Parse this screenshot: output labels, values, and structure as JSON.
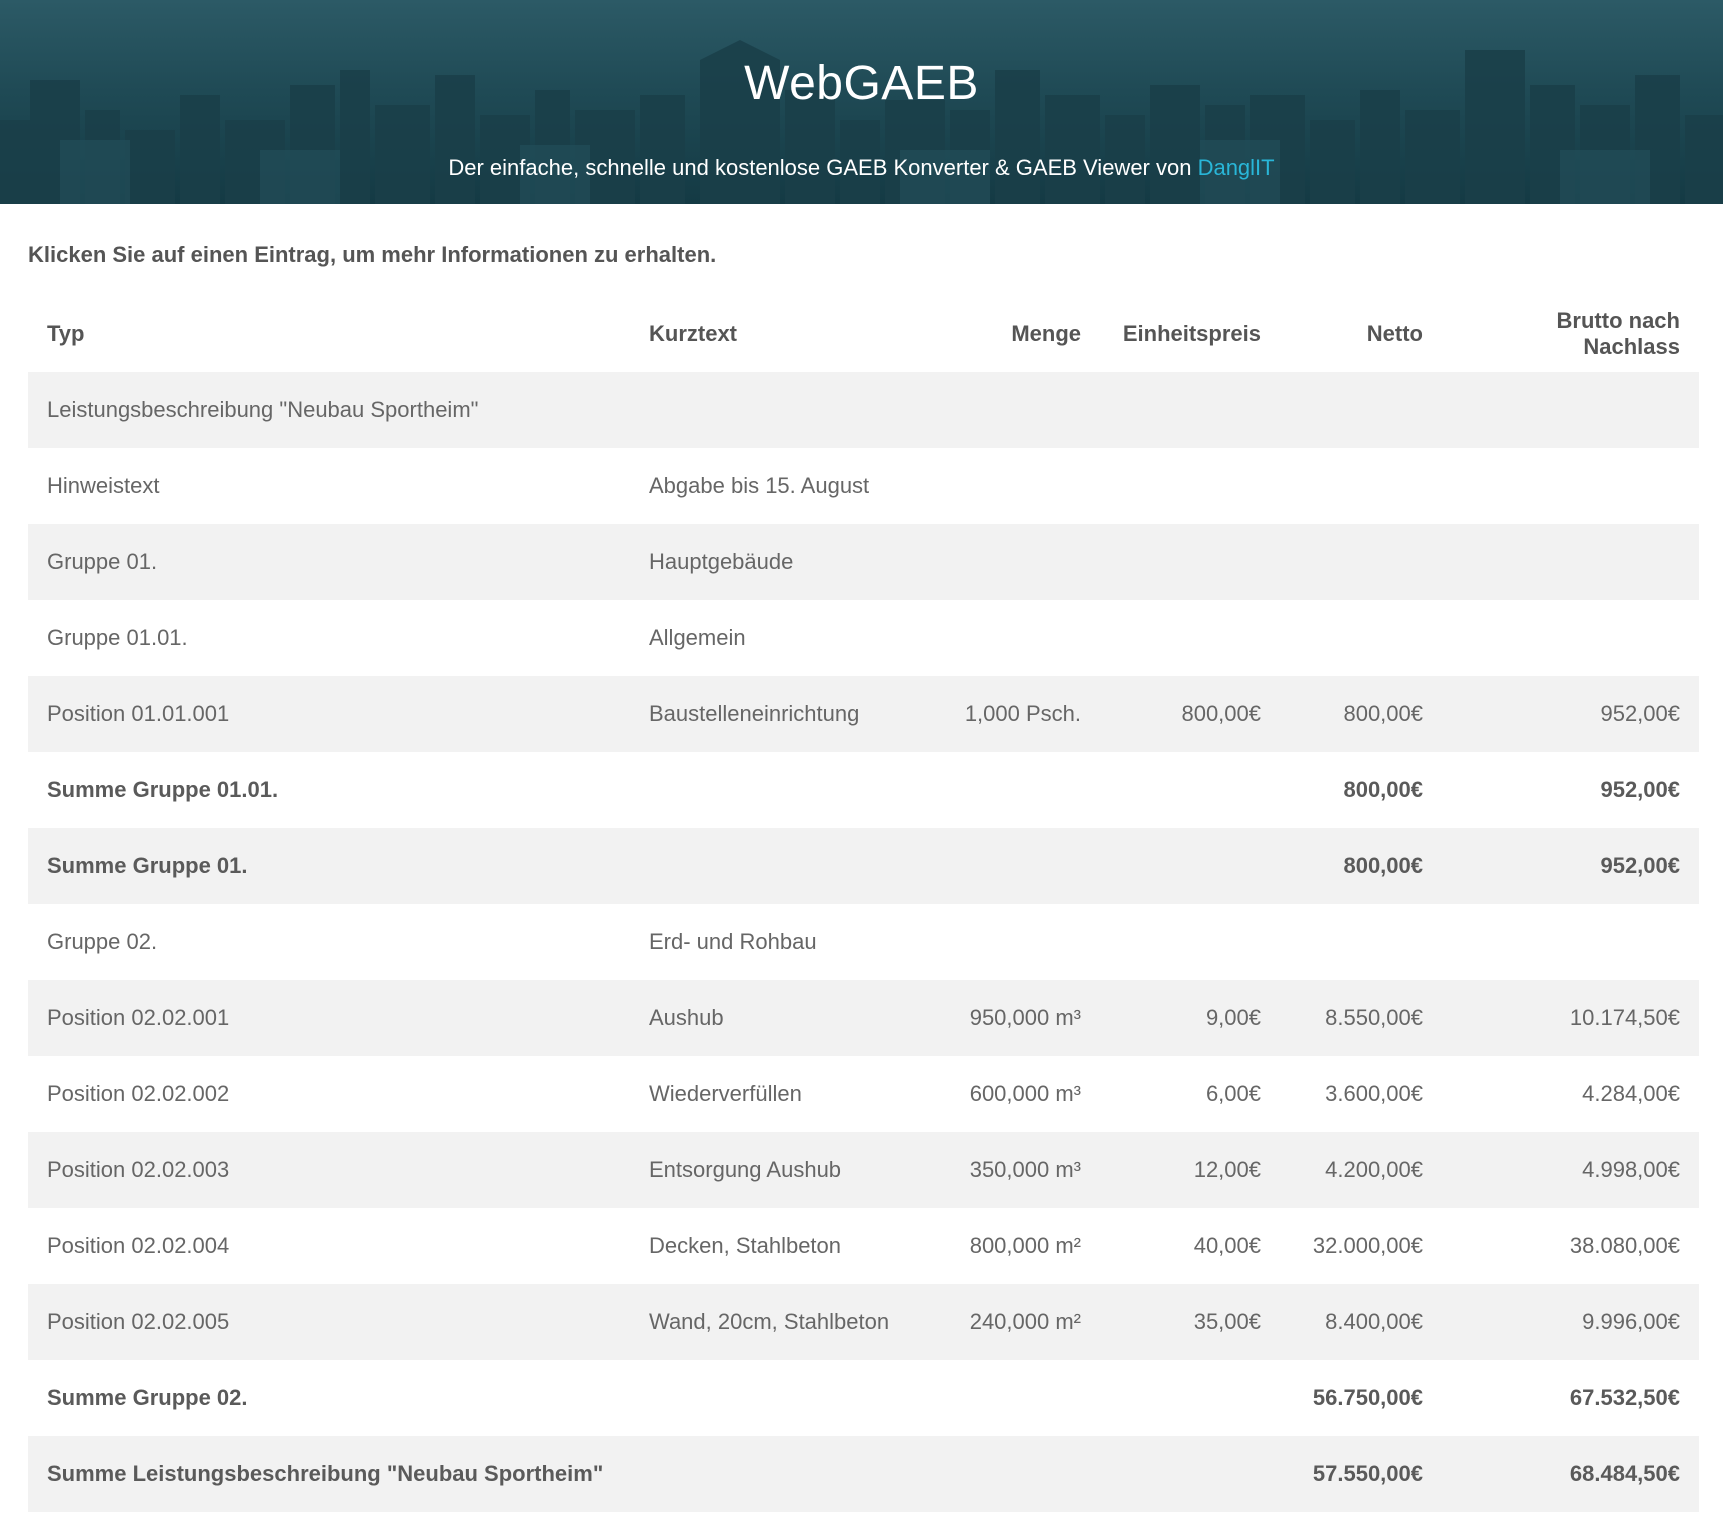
{
  "header": {
    "title_light": "Web",
    "title_strong": "GAEB",
    "subtitle_text": "Der einfache, schnelle und kostenlose GAEB Konverter & GAEB Viewer von ",
    "subtitle_link": "DanglIT"
  },
  "instruction": "Klicken Sie auf einen Eintrag, um mehr Informationen zu erhalten.",
  "table": {
    "headers": {
      "typ": "Typ",
      "kurztext": "Kurztext",
      "menge": "Menge",
      "einheitspreis": "Einheitspreis",
      "netto": "Netto",
      "brutto": "Brutto nach Nachlass"
    },
    "rows": [
      {
        "typ": "Leistungsbeschreibung \"Neubau Sportheim\"",
        "kurztext": "",
        "menge": "",
        "einheitspreis": "",
        "netto": "",
        "brutto": ""
      },
      {
        "typ": "Hinweistext",
        "kurztext": "Abgabe bis 15. August",
        "menge": "",
        "einheitspreis": "",
        "netto": "",
        "brutto": ""
      },
      {
        "typ": "Gruppe 01.",
        "kurztext": "Hauptgebäude",
        "menge": "",
        "einheitspreis": "",
        "netto": "",
        "brutto": ""
      },
      {
        "typ": "Gruppe 01.01.",
        "kurztext": "Allgemein",
        "menge": "",
        "einheitspreis": "",
        "netto": "",
        "brutto": ""
      },
      {
        "typ": "Position 01.01.001",
        "kurztext": "Baustelleneinrichtung",
        "menge": "1,000 Psch.",
        "einheitspreis": "800,00€",
        "netto": "800,00€",
        "brutto": "952,00€"
      },
      {
        "typ": "Summe Gruppe 01.01.",
        "kurztext": "",
        "menge": "",
        "einheitspreis": "",
        "netto": "800,00€",
        "brutto": "952,00€"
      },
      {
        "typ": "Summe Gruppe 01.",
        "kurztext": "",
        "menge": "",
        "einheitspreis": "",
        "netto": "800,00€",
        "brutto": "952,00€"
      },
      {
        "typ": "Gruppe 02.",
        "kurztext": "Erd- und Rohbau",
        "menge": "",
        "einheitspreis": "",
        "netto": "",
        "brutto": ""
      },
      {
        "typ": "Position 02.02.001",
        "kurztext": "Aushub",
        "menge": "950,000 m³",
        "einheitspreis": "9,00€",
        "netto": "8.550,00€",
        "brutto": "10.174,50€"
      },
      {
        "typ": "Position 02.02.002",
        "kurztext": "Wiederverfüllen",
        "menge": "600,000 m³",
        "einheitspreis": "6,00€",
        "netto": "3.600,00€",
        "brutto": "4.284,00€"
      },
      {
        "typ": "Position 02.02.003",
        "kurztext": "Entsorgung Aushub",
        "menge": "350,000 m³",
        "einheitspreis": "12,00€",
        "netto": "4.200,00€",
        "brutto": "4.998,00€"
      },
      {
        "typ": "Position 02.02.004",
        "kurztext": "Decken, Stahlbeton",
        "menge": "800,000 m²",
        "einheitspreis": "40,00€",
        "netto": "32.000,00€",
        "brutto": "38.080,00€"
      },
      {
        "typ": "Position 02.02.005",
        "kurztext": "Wand, 20cm, Stahlbeton",
        "menge": "240,000 m²",
        "einheitspreis": "35,00€",
        "netto": "8.400,00€",
        "brutto": "9.996,00€"
      },
      {
        "typ": "Summe Gruppe 02.",
        "kurztext": "",
        "menge": "",
        "einheitspreis": "",
        "netto": "56.750,00€",
        "brutto": "67.532,50€"
      },
      {
        "typ": "Summe Leistungsbeschreibung \"Neubau Sportheim\"",
        "kurztext": "",
        "menge": "",
        "einheitspreis": "",
        "netto": "57.550,00€",
        "brutto": "68.484,50€"
      }
    ]
  },
  "colors": {
    "header_bg": "#1f4a55",
    "link": "#29b6d8",
    "row_stripe": "#f2f2f2",
    "text": "#666666"
  }
}
